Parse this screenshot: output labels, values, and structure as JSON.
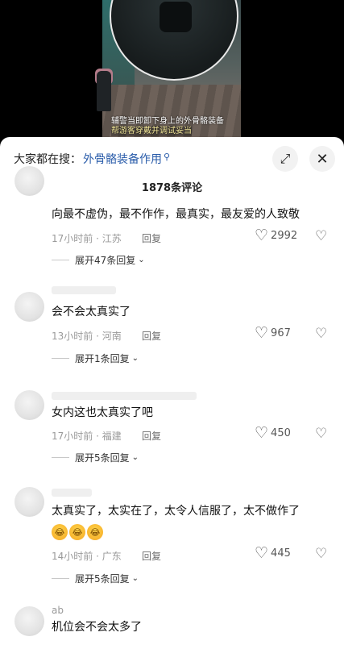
{
  "video": {
    "caption_line1": "辅警当即卸下身上的外骨骼装备",
    "caption_line2": "帮游客穿戴并调试妥当"
  },
  "header": {
    "search_prefix": "大家都在搜：",
    "search_keyword": "外骨骼装备作用",
    "search_icon": "search-icon",
    "expand_icon": "expand-icon",
    "close_label": "✕"
  },
  "comment_count": "1878条评论",
  "comments": [
    {
      "text": "向最不虚伪，最不作作，最真实，最友爱的人致敬",
      "time": "17小时前",
      "location": "江苏",
      "reply_label": "回复",
      "likes": "2992",
      "expand_label": "展开47条回复"
    },
    {
      "text": "会不会太真实了",
      "time": "13小时前",
      "location": "河南",
      "reply_label": "回复",
      "likes": "967",
      "expand_label": "展开1条回复"
    },
    {
      "text": "女内这也太真实了吧",
      "time": "17小时前",
      "location": "福建",
      "reply_label": "回复",
      "likes": "450",
      "expand_label": "展开5条回复"
    },
    {
      "text": "太真实了，太实在了，太令人信服了，太不做作了",
      "emojis": [
        "😂",
        "😂",
        "😂"
      ],
      "time": "14小时前",
      "location": "广东",
      "reply_label": "回复",
      "likes": "445",
      "expand_label": "展开5条回复"
    },
    {
      "nickname": "ab",
      "text": "机位会不会太多了"
    }
  ],
  "meta_separator": " · "
}
